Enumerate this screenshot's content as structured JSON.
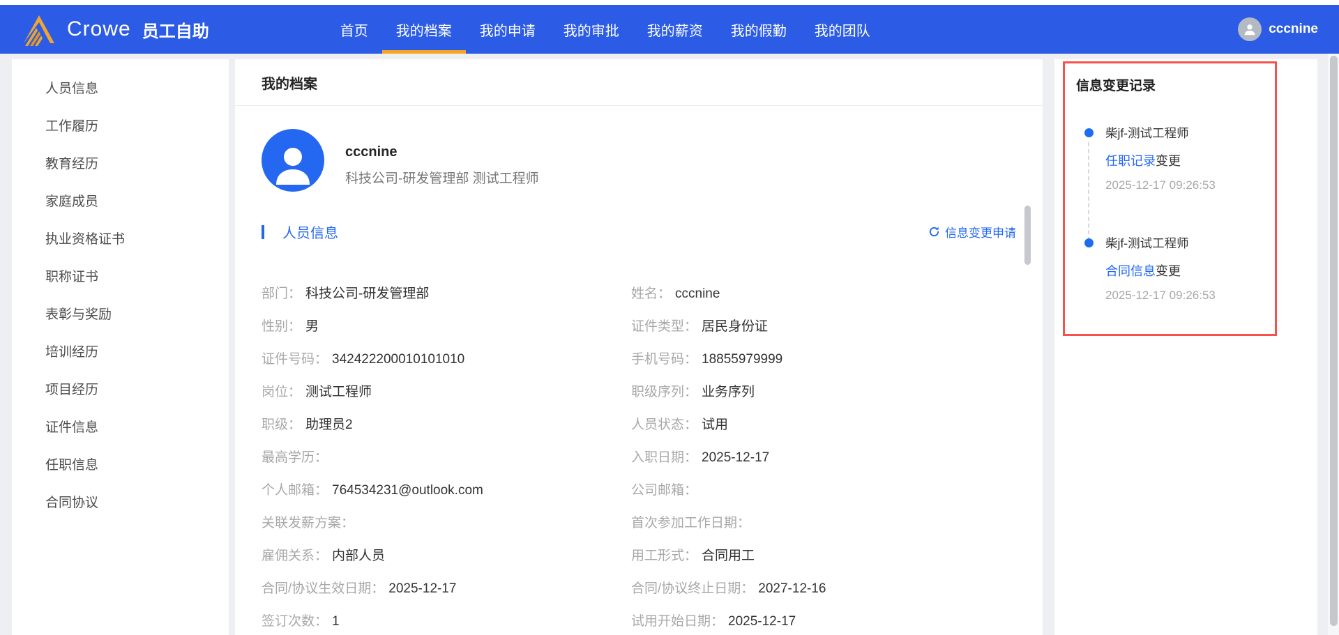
{
  "navbar": {
    "brand": "Crowe",
    "app_title": "员工自助",
    "items": [
      {
        "label": "首页",
        "active": false
      },
      {
        "label": "我的档案",
        "active": true
      },
      {
        "label": "我的申请",
        "active": false
      },
      {
        "label": "我的审批",
        "active": false
      },
      {
        "label": "我的薪资",
        "active": false
      },
      {
        "label": "我的假勤",
        "active": false
      },
      {
        "label": "我的团队",
        "active": false
      }
    ],
    "user": "cccnine"
  },
  "sidebar": {
    "items": [
      "人员信息",
      "工作履历",
      "教育经历",
      "家庭成员",
      "执业资格证书",
      "职称证书",
      "表彰与奖励",
      "培训经历",
      "项目经历",
      "证件信息",
      "任职信息",
      "合同协议"
    ]
  },
  "main": {
    "title": "我的档案",
    "profile": {
      "name": "cccnine",
      "subtitle": "科技公司-研发管理部 测试工程师"
    },
    "section_title": "人员信息",
    "change_request_label": "信息变更申请",
    "fields": [
      {
        "label": "部门：",
        "value": "科技公司-研发管理部"
      },
      {
        "label": "姓名：",
        "value": "cccnine"
      },
      {
        "label": "性别：",
        "value": "男"
      },
      {
        "label": "证件类型：",
        "value": "居民身份证"
      },
      {
        "label": "证件号码：",
        "value": "342422200010101010"
      },
      {
        "label": "手机号码：",
        "value": "18855979999"
      },
      {
        "label": "岗位：",
        "value": "测试工程师"
      },
      {
        "label": "职级序列：",
        "value": "业务序列"
      },
      {
        "label": "职级：",
        "value": "助理员2"
      },
      {
        "label": "人员状态：",
        "value": "试用"
      },
      {
        "label": "最高学历：",
        "value": ""
      },
      {
        "label": "入职日期：",
        "value": "2025-12-17"
      },
      {
        "label": "个人邮箱：",
        "value": "764534231@outlook.com"
      },
      {
        "label": "公司邮箱：",
        "value": ""
      },
      {
        "label": "关联发薪方案：",
        "value": ""
      },
      {
        "label": "首次参加工作日期：",
        "value": ""
      },
      {
        "label": "雇佣关系：",
        "value": "内部人员"
      },
      {
        "label": "用工形式：",
        "value": "合同用工"
      },
      {
        "label": "合同/协议生效日期：",
        "value": "2025-12-17"
      },
      {
        "label": "合同/协议终止日期：",
        "value": "2027-12-16"
      },
      {
        "label": "签订次数：",
        "value": "1"
      },
      {
        "label": "试用开始日期：",
        "value": "2025-12-17"
      }
    ]
  },
  "change_log": {
    "title": "信息变更记录",
    "entries": [
      {
        "who": "柴jf-测试工程师",
        "link": "任职记录",
        "suffix": "变更",
        "time": "2025-12-17 09:26:53"
      },
      {
        "who": "柴jf-测试工程师",
        "link": "合同信息",
        "suffix": "变更",
        "time": "2025-12-17 09:26:53"
      }
    ]
  },
  "colors": {
    "navbar_bg": "#2c5ce5",
    "nav_active_underline": "#f5a623",
    "logo_gold": "#f0a432",
    "link_blue": "#2468f2",
    "timeline_dot_blue": "#1f6bf2",
    "annotation_red": "#f8514b",
    "label_gray": "#a8a8a8",
    "value_dark": "#333333"
  }
}
